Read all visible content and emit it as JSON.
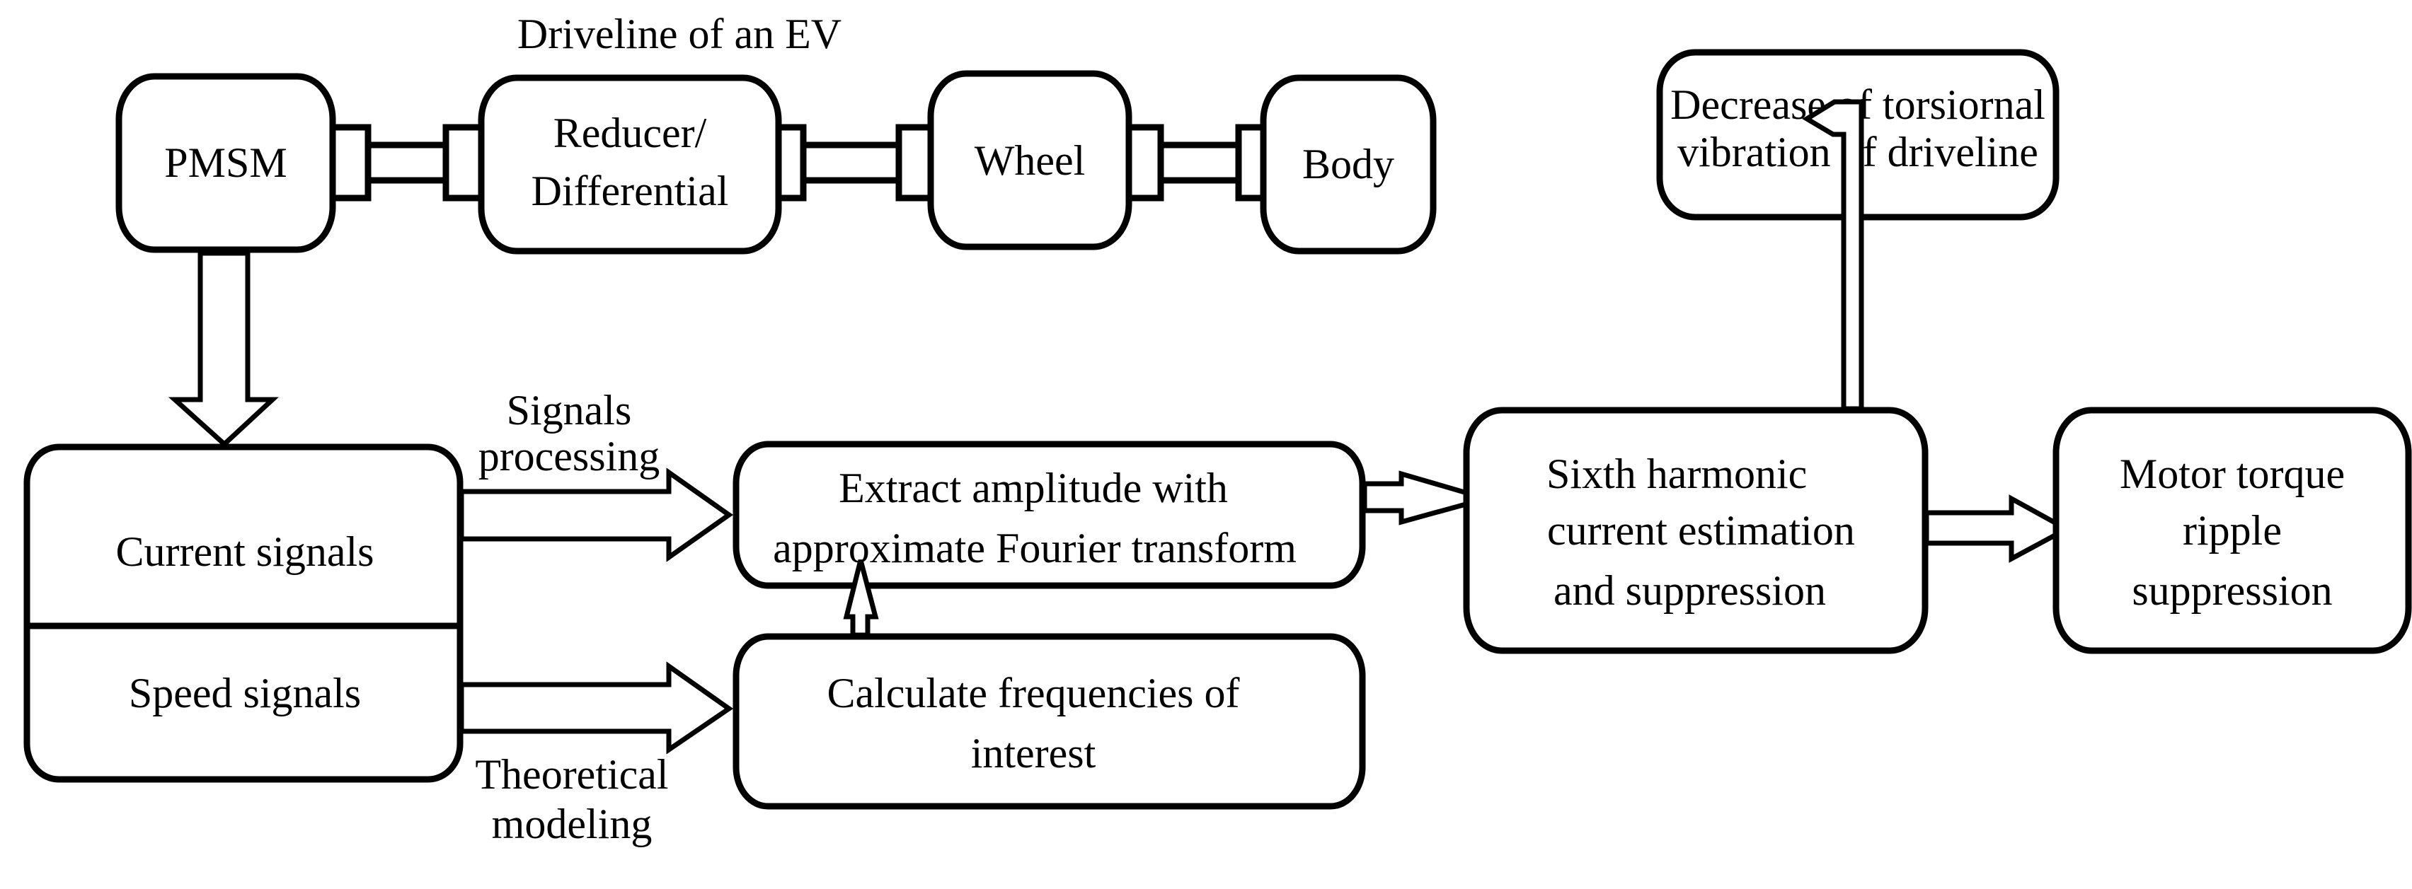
{
  "title": "Driveline of an EV",
  "driveline": {
    "pmsm": "PMSM",
    "reducer": [
      "Reducer/",
      "Differential"
    ],
    "wheel": "Wheel",
    "body": "Body"
  },
  "signals": {
    "current": "Current signals",
    "speed": "Speed signals"
  },
  "edge_labels": {
    "signals_processing": [
      "Signals",
      "processing"
    ],
    "theoretical_modeling": [
      "Theoretical",
      "modeling"
    ]
  },
  "steps": {
    "extract": [
      "Extract amplitude with",
      "approximate Fourier transform"
    ],
    "calculate": [
      "Calculate frequencies of",
      "interest"
    ],
    "sixth": [
      "Sixth harmonic",
      "current estimation",
      "and suppression"
    ],
    "motor": [
      "Motor torque",
      "ripple",
      "suppression"
    ],
    "decrease": [
      "Decrease of torsiornal",
      "vibration of  driveline"
    ]
  }
}
